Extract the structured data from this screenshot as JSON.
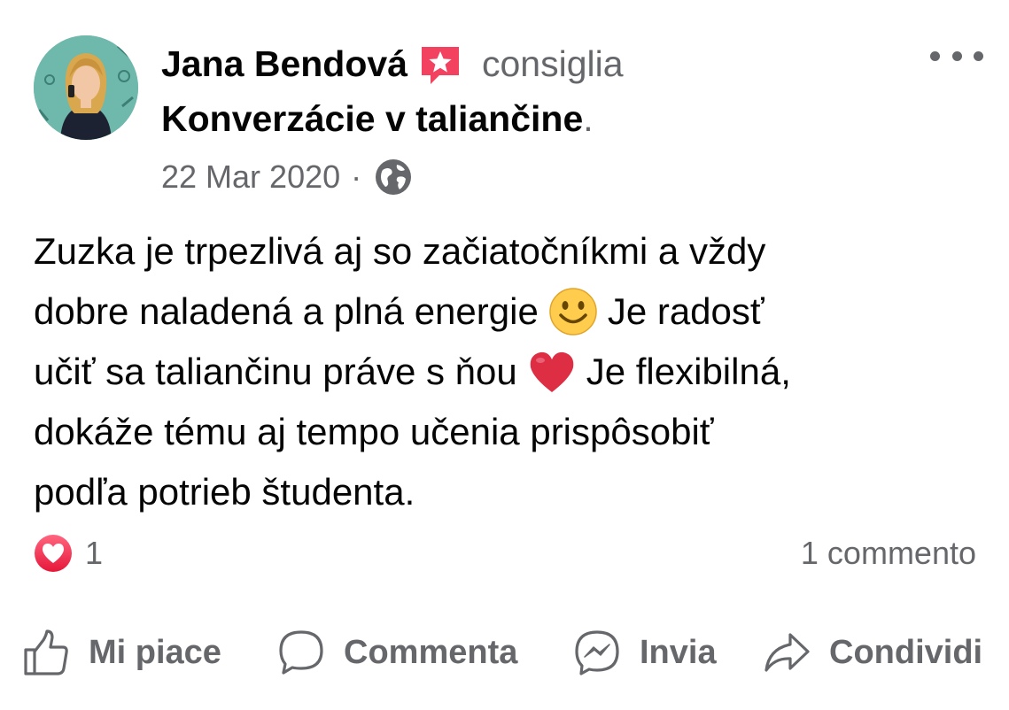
{
  "post": {
    "author": {
      "name": "Jana Bendová",
      "action": "consiglia",
      "badge_icon": "recommend-star-icon"
    },
    "page": {
      "name": "Konverzácie v taliančine",
      "trailing": "."
    },
    "meta": {
      "date": "22 Mar 2020",
      "separator": "·",
      "privacy_icon": "globe-icon"
    },
    "body": {
      "lines": [
        {
          "before": "Zuzka je trpezlivá aj so začiatočníkmi a vždy",
          "emoji": "",
          "after": ""
        },
        {
          "before": "dobre naladená a plná energie",
          "emoji": "smiley-emoji",
          "after": "Je radosť"
        },
        {
          "before": "učiť sa taliančinu práve s ňou",
          "emoji": "heart-emoji",
          "after": "Je flexibilná,"
        },
        {
          "before": "dokáže tému aj tempo učenia prispôsobiť",
          "emoji": "",
          "after": ""
        },
        {
          "before": "podľa potrieb študenta.",
          "emoji": "",
          "after": ""
        }
      ]
    },
    "reactions": {
      "icon": "love-reaction-icon",
      "count": "1",
      "comments": "1 commento"
    },
    "actions": [
      {
        "label": "Mi piace",
        "icon": "thumbs-up-icon"
      },
      {
        "label": "Commenta",
        "icon": "comment-bubble-icon"
      },
      {
        "label": "Invia",
        "icon": "messenger-icon"
      },
      {
        "label": "Condividi",
        "icon": "share-arrow-icon"
      }
    ]
  },
  "colors": {
    "text_primary": "#050505",
    "text_secondary": "#65676b",
    "badge_pink": "#f3425f",
    "love_red": "#f33e58",
    "emoji_yellow": "#ffcc4d"
  }
}
